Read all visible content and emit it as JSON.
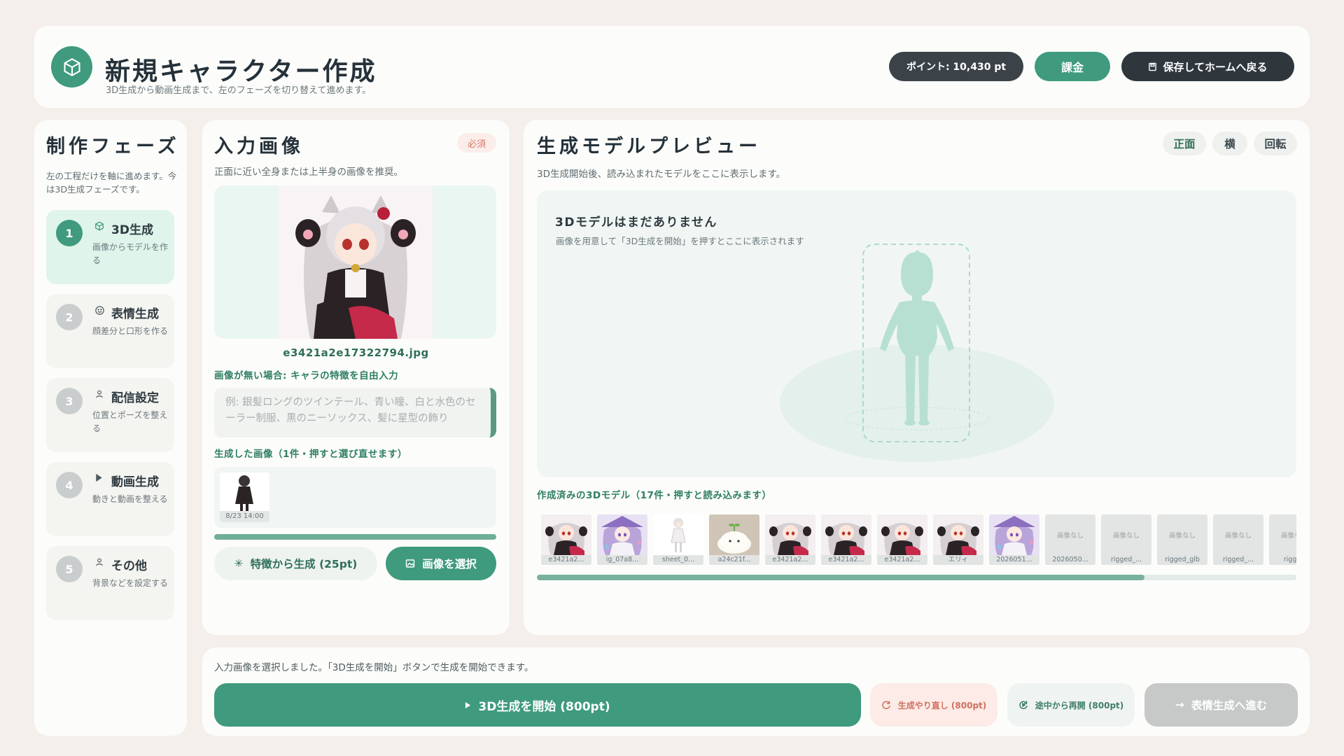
{
  "header": {
    "title": "新規キャラクター作成",
    "subtitle": "3D生成から動画生成まで、左のフェーズを切り替えて進めます。",
    "points": "ポイント: 10,430 pt",
    "charge": "課金",
    "save_home": "保存してホームへ戻る"
  },
  "sidebar": {
    "title": "制作フェーズ",
    "desc": "左の工程だけを軸に進めます。今は3D生成フェーズです。",
    "phases": [
      {
        "num": "1",
        "title": "3D生成",
        "desc": "画像からモデルを作る",
        "icon": "cube-icon"
      },
      {
        "num": "2",
        "title": "表情生成",
        "desc": "顔差分と口形を作る",
        "icon": "smile-icon"
      },
      {
        "num": "3",
        "title": "配信設定",
        "desc": "位置とポーズを整える",
        "icon": "person-icon"
      },
      {
        "num": "4",
        "title": "動画生成",
        "desc": "動きと動画を整える",
        "icon": "play-icon"
      },
      {
        "num": "5",
        "title": "その他",
        "desc": "背景などを設定する",
        "icon": "person-icon"
      }
    ]
  },
  "input_panel": {
    "title": "入力画像",
    "required": "必須",
    "desc": "正面に近い全身または上半身の画像を推奨。",
    "filename": "e3421a2e17322794.jpg",
    "no_image_label": "画像が無い場合: キャラの特徴を自由入力",
    "placeholder": "例: 銀髪ロングのツインテール、青い瞳、白と水色のセーラー制服、黒のニーソックス、髪に星型の飾り",
    "generated_label": "生成した画像（1件・押すと選び直せます）",
    "generated_thumb_caption": "8/23 14:00",
    "btn_feature": "特徴から生成 (25pt)",
    "btn_select": "画像を選択"
  },
  "preview_panel": {
    "title": "生成モデルプレビュー",
    "desc": "3D生成開始後、読み込まれたモデルをここに表示します。",
    "tabs": [
      "正面",
      "横",
      "回転"
    ],
    "empty_title": "3Dモデルはまだありません",
    "empty_desc": "画像を用意して「3D生成を開始」を押すとここに表示されます",
    "models_label": "作成済みの3Dモデル（17件・押すと読み込みます）",
    "no_image_text": "画像なし",
    "models": [
      {
        "caption": "e3421a2...",
        "kind": "anime"
      },
      {
        "caption": "ig_07a8...",
        "kind": "purple"
      },
      {
        "caption": "sheet_0...",
        "kind": "sheet"
      },
      {
        "caption": "a24c21f...",
        "kind": "mochi"
      },
      {
        "caption": "e3421a2...",
        "kind": "anime"
      },
      {
        "caption": "e3421a2...",
        "kind": "anime"
      },
      {
        "caption": "e3421a2...",
        "kind": "anime"
      },
      {
        "caption": "エリィ",
        "kind": "anime"
      },
      {
        "caption": "2026051...",
        "kind": "purple"
      },
      {
        "caption": "2026050...",
        "kind": "none"
      },
      {
        "caption": "rigged_...",
        "kind": "none"
      },
      {
        "caption": "rigged_glb",
        "kind": "none"
      },
      {
        "caption": "rigged_...",
        "kind": "none"
      },
      {
        "caption": "rigged",
        "kind": "none"
      }
    ],
    "scroll_fraction": 0.8
  },
  "bottom_bar": {
    "status": "入力画像を選択しました。「3D生成を開始」ボタンで生成を開始できます。",
    "start": "3D生成を開始 (800pt)",
    "retry": "生成やり直し (800pt)",
    "resume": "途中から再開 (800pt)",
    "next": "表情生成へ進む"
  },
  "colors": {
    "accent": "#3f9a7e",
    "dark": "#2f373d",
    "required": "#d9786a"
  }
}
